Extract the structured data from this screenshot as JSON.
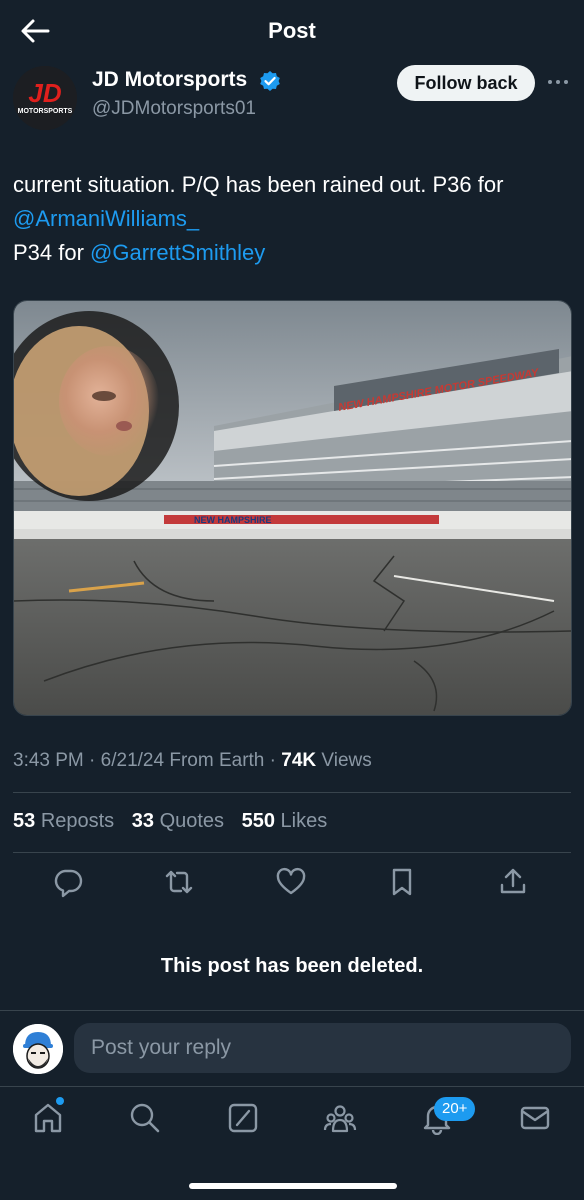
{
  "header": {
    "title": "Post",
    "back_icon": "arrow-left-icon"
  },
  "author": {
    "name": "JD Motorsports",
    "handle": "@JDMotorsports01",
    "verified": true,
    "follow_label": "Follow back",
    "logo_text": "JD",
    "logo_subtext": "MOTORSPORTS"
  },
  "post": {
    "text_1": "current situation. P/Q has been rained out. P36 for ",
    "mention_1": "@ArmaniWilliams_",
    "text_2": "P34 for ",
    "mention_2": "@GarrettSmithley",
    "image_signage_1": "NEW HAMPSHIRE MOTOR SPEEDWAY",
    "image_signage_2": "NEW HAMPSHIRE"
  },
  "meta": {
    "time": "3:43 PM",
    "date": "6/21/24",
    "source": "From Earth",
    "views_count": "74K",
    "views_label": "Views",
    "sep": "·"
  },
  "stats": {
    "reposts_count": "53",
    "reposts_label": "Reposts",
    "quotes_count": "33",
    "quotes_label": "Quotes",
    "likes_count": "550",
    "likes_label": "Likes"
  },
  "notice": "This post has been deleted.",
  "reply": {
    "placeholder": "Post your reply"
  },
  "tabbar": {
    "notifications_badge": "20+"
  },
  "colors": {
    "background": "#15202b",
    "accent": "#1d9bf0",
    "muted": "#8b98a5",
    "divider": "#38444d"
  }
}
